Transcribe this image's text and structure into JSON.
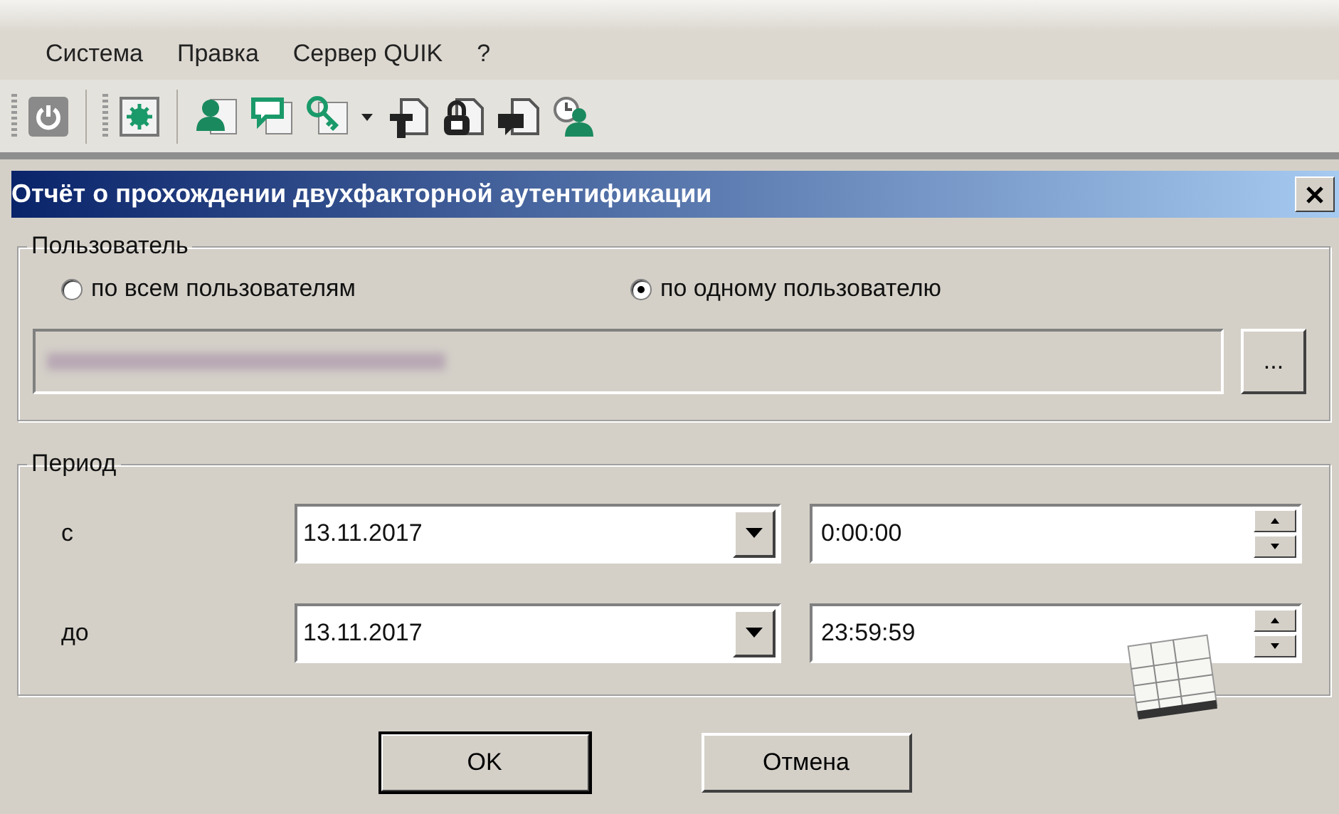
{
  "menu": [
    "Система",
    "Правка",
    "Сервер QUIK",
    "?"
  ],
  "dialog": {
    "title": "Отчёт о прохождении двухфакторной аутентификации",
    "user_group": {
      "title": "Пользователь",
      "options": [
        {
          "label": "по всем пользователям",
          "selected": false
        },
        {
          "label": "по одному пользователю",
          "selected": true
        }
      ],
      "browse_label": "..."
    },
    "period_group": {
      "title": "Период",
      "rows": [
        {
          "label": "с",
          "date": "13.11.2017",
          "time": "0:00:00"
        },
        {
          "label": "до",
          "date": "13.11.2017",
          "time": "23:59:59"
        }
      ]
    },
    "buttons": [
      {
        "label": "OK",
        "default": true
      },
      {
        "label": "Отмена",
        "default": false
      }
    ]
  }
}
